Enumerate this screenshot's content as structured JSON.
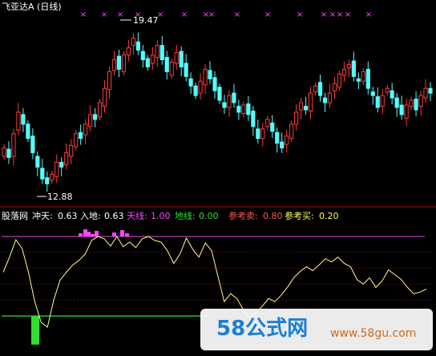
{
  "title": "飞亚达A (日线)",
  "colors": {
    "up": "#ff3b3b",
    "down": "#54ffff",
    "indicator": "#ffff88",
    "signal_mark": "#ff44ff",
    "upper_line": "#cc44cc",
    "lower_line": "#33dd33",
    "separator": "#b00000",
    "tianxian": "#ff44ff",
    "dixian": "#33dd33",
    "sell": "#ff5555",
    "buy": "#ffff55"
  },
  "chart_data": [
    {
      "type": "candlestick",
      "title": "飞亚达A (日线)",
      "annotations": [
        {
          "label": "19.47",
          "kind": "high"
        },
        {
          "label": "12.88",
          "kind": "low"
        }
      ],
      "ylim": [
        12.4,
        20.2
      ],
      "signal_marks": [
        "×",
        "×",
        "×",
        "×",
        "×",
        "×",
        "×",
        "×",
        "×",
        "×",
        "×",
        "×",
        "×",
        "×",
        "×",
        "×"
      ],
      "close_path": [
        14.6,
        14.2,
        15.2,
        16.1,
        15.6,
        15.0,
        14.4,
        13.8,
        13.3,
        13.1,
        13.5,
        14.0,
        13.8,
        14.4,
        14.7,
        15.2,
        15.0,
        15.6,
        16.0,
        15.8,
        16.5,
        17.1,
        17.8,
        18.3,
        17.9,
        18.5,
        18.8,
        19.2,
        18.7,
        18.3,
        18.0,
        18.5,
        18.9,
        18.3,
        17.8,
        18.2,
        18.6,
        18.0,
        17.6,
        17.2,
        16.8,
        17.4,
        17.9,
        17.5,
        17.0,
        16.6,
        16.3,
        16.8,
        16.5,
        16.1,
        16.4,
        16.0,
        15.5,
        15.0,
        15.4,
        15.8,
        15.3,
        14.8,
        14.6,
        15.1,
        15.6,
        16.1,
        16.5,
        16.2,
        16.9,
        17.2,
        16.8,
        16.5,
        16.9,
        17.3,
        17.7,
        17.9,
        18.1,
        17.6,
        17.4,
        17.8,
        17.1,
        16.8,
        16.3,
        16.8,
        17.1,
        16.7,
        16.3,
        16.0,
        16.4,
        16.6,
        16.2,
        16.8,
        17.1,
        16.9
      ]
    },
    {
      "type": "line",
      "title": "股落网",
      "ylim": [
        -0.12,
        1.1
      ],
      "legend": [
        {
          "label": "冲天:",
          "value": "0.63"
        },
        {
          "label": "入地:",
          "value": "0.63"
        },
        {
          "label": "天线:",
          "value": "1.00"
        },
        {
          "label": "地线:",
          "value": "0.00"
        },
        {
          "label": "参考卖:",
          "value": "0.80"
        },
        {
          "label": "参考买:",
          "value": "0.20"
        }
      ],
      "reference_lines": [
        1.0,
        0.0
      ],
      "dotted_levels": [
        0.8,
        0.6,
        0.4,
        0.2
      ],
      "values": [
        0.55,
        0.74,
        0.96,
        0.85,
        0.55,
        0.18,
        -0.08,
        -0.14,
        0.2,
        0.45,
        0.55,
        0.64,
        0.7,
        0.78,
        0.95,
        1.0,
        0.97,
        0.88,
        1.0,
        0.87,
        0.93,
        0.86,
        0.97,
        1.0,
        0.95,
        0.93,
        0.82,
        0.66,
        0.78,
        0.98,
        0.84,
        0.74,
        0.92,
        0.82,
        0.5,
        0.18,
        0.28,
        0.22,
        0.08,
        -0.02,
        0.04,
        0.12,
        0.22,
        0.18,
        0.26,
        0.36,
        0.48,
        0.56,
        0.62,
        0.57,
        0.64,
        0.72,
        0.68,
        0.74,
        0.66,
        0.62,
        0.46,
        0.4,
        0.48,
        0.36,
        0.44,
        0.58,
        0.52,
        0.46,
        0.36,
        0.28,
        0.3,
        0.34
      ],
      "pink_bars": [
        0.04,
        0.09,
        0.06,
        0.03,
        0.07,
        0.05,
        0.08,
        0.04
      ],
      "green_bar_value": -0.36
    }
  ],
  "watermark": {
    "logo": "58公式网",
    "url": "www.58gu.com"
  }
}
